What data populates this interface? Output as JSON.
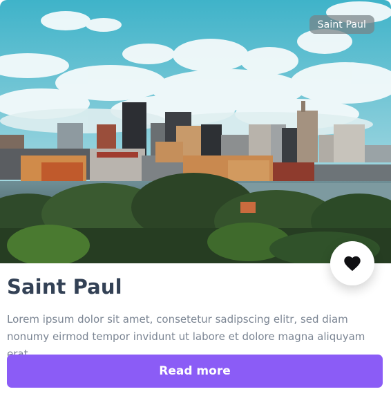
{
  "card": {
    "location_tag": "Saint Paul",
    "title": "Saint Paul",
    "description": "Lorem ipsum dolor sit amet, consetetur sadipscing elitr, sed diam nonumy eirmod tempor invidunt ut labore et dolore magna aliquyam erat..",
    "read_more_label": "Read more"
  },
  "icons": {
    "favorite": "heart-icon"
  },
  "colors": {
    "accent": "#8b5cf6",
    "title": "#334155",
    "description": "#7b8593",
    "tag_bg": "#788287"
  }
}
